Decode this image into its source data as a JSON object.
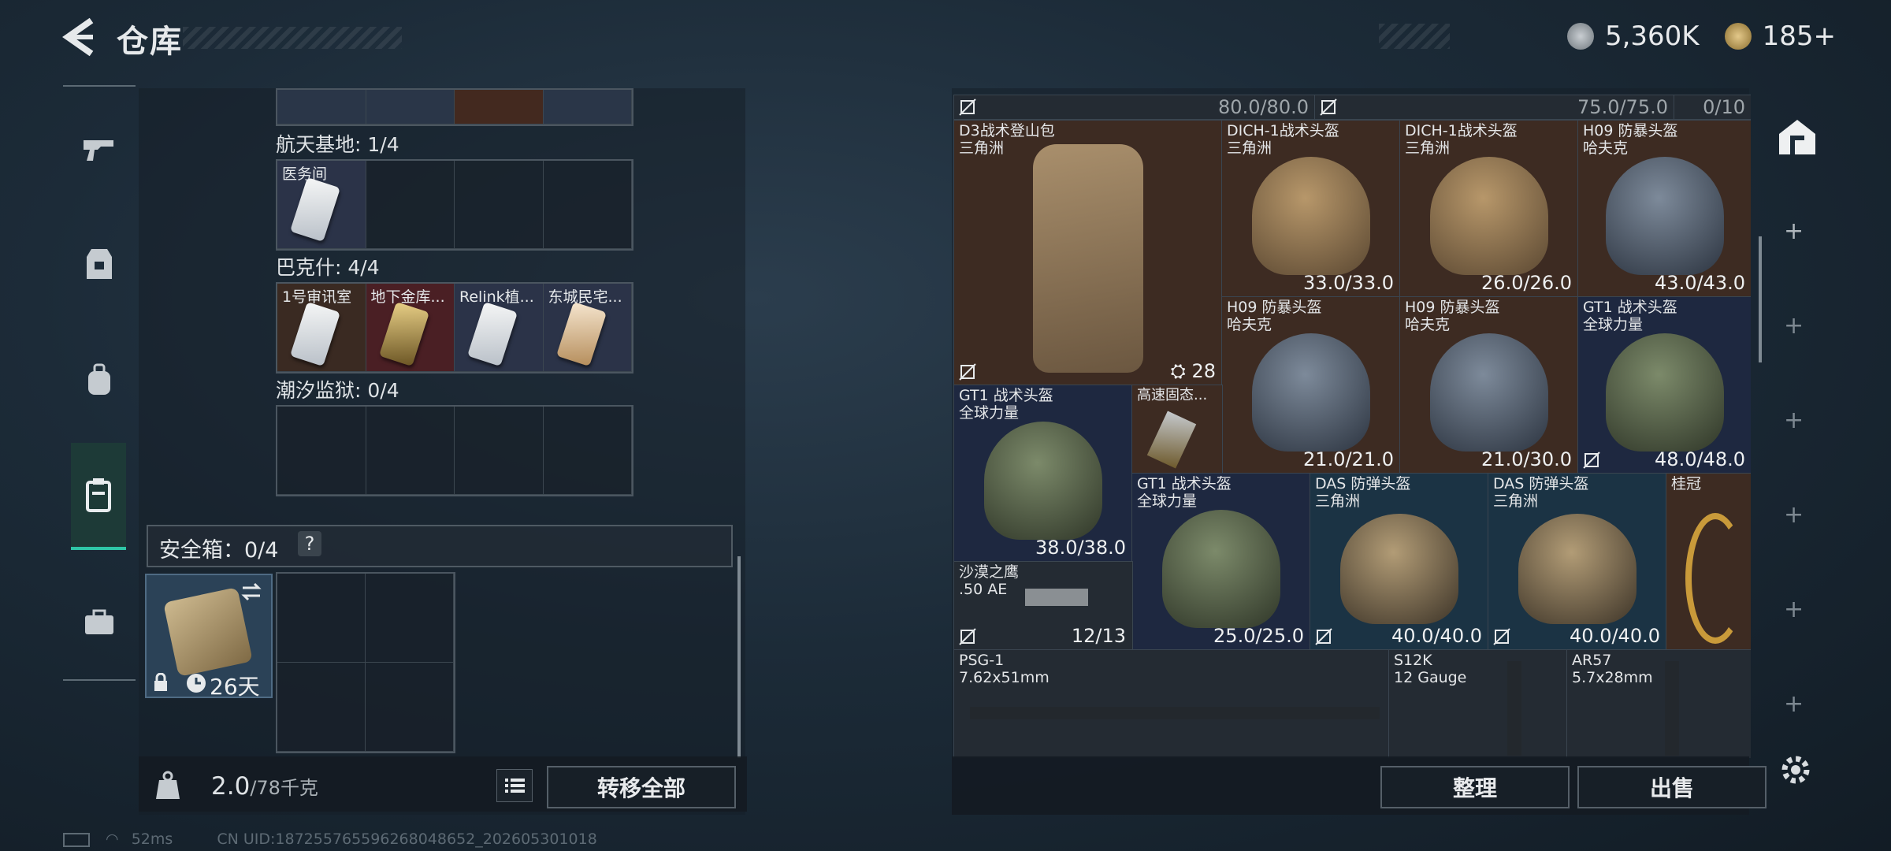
{
  "header": {
    "title": "仓库"
  },
  "currency": {
    "silver": "5,360K",
    "gold": "185+"
  },
  "left_nav": {
    "items": [
      "gun-icon",
      "armor-icon",
      "backpack-icon",
      "container-icon",
      "toolbox-icon"
    ]
  },
  "container": {
    "sections": [
      {
        "label": "航天基地: 1/4",
        "cells": [
          "医务间",
          "",
          "",
          ""
        ]
      },
      {
        "label": "巴克什: 4/4",
        "cells": [
          "1号审讯室",
          "地下金库...",
          "Relink植...",
          "东城民宅..."
        ]
      },
      {
        "label": "潮汐监狱: 0/4",
        "cells": [
          "",
          "",
          "",
          ""
        ]
      }
    ],
    "safe": {
      "label": "安全箱：0/4",
      "help": "?",
      "timer": "26天"
    }
  },
  "weight": {
    "current": "2.0",
    "max": "/78千克"
  },
  "buttons": {
    "transfer_all": "转移全部",
    "sort": "整理",
    "sell": "出售"
  },
  "status": {
    "ping": "52ms",
    "uid": "CN UID:1872557655962680486​52_202605301018"
  },
  "stash": {
    "top_row": {
      "left_value": "80.0/80.0",
      "right_value": "75.0/75.0",
      "count": "0/10"
    },
    "items": [
      {
        "name": "D3战术登山包",
        "sub": "三角洲",
        "extra": "28"
      },
      {
        "name": "DICH-1战术头盔",
        "sub": "三角洲",
        "dur": "33.0/33.0"
      },
      {
        "name": "DICH-1战术头盔",
        "sub": "三角洲",
        "dur": "26.0/26.0"
      },
      {
        "name": "H09 防暴头盔",
        "sub": "哈夫克",
        "dur": "43.0/43.0"
      },
      {
        "name": "H09 防暴头盔",
        "sub": "哈夫克",
        "dur": "21.0/21.0"
      },
      {
        "name": "H09 防暴头盔",
        "sub": "哈夫克",
        "dur": "21.0/30.0"
      },
      {
        "name": "GT1 战术头盔",
        "sub": "全球力量",
        "dur": "48.0/48.0"
      },
      {
        "name": "GT1 战术头盔",
        "sub": "全球力量",
        "dur": "38.0/38.0"
      },
      {
        "name": "高速固态...",
        "sub": "",
        "dur": ""
      },
      {
        "name": "GT1 战术头盔",
        "sub": "全球力量",
        "dur": "25.0/25.0"
      },
      {
        "name": "DAS 防弹头盔",
        "sub": "三角洲",
        "dur": "40.0/40.0"
      },
      {
        "name": "DAS 防弹头盔",
        "sub": "三角洲",
        "dur": "40.0/40.0"
      },
      {
        "name": "桂冠",
        "sub": "",
        "dur": ""
      },
      {
        "name": "沙漠之鹰",
        "sub": ".50 AE",
        "dur": "12/13"
      },
      {
        "name": "PSG-1",
        "sub": "7.62x51mm",
        "dur": ""
      },
      {
        "name": "S12K",
        "sub": "12 Gauge",
        "dur": ""
      },
      {
        "name": "AR57",
        "sub": "5.7x28mm",
        "dur": ""
      }
    ]
  },
  "colors": {
    "accent": "#2fc6a7",
    "rarity_orange": "#3d2b22",
    "rarity_blue": "#1e2840",
    "rarity_teal": "#1b3344"
  }
}
